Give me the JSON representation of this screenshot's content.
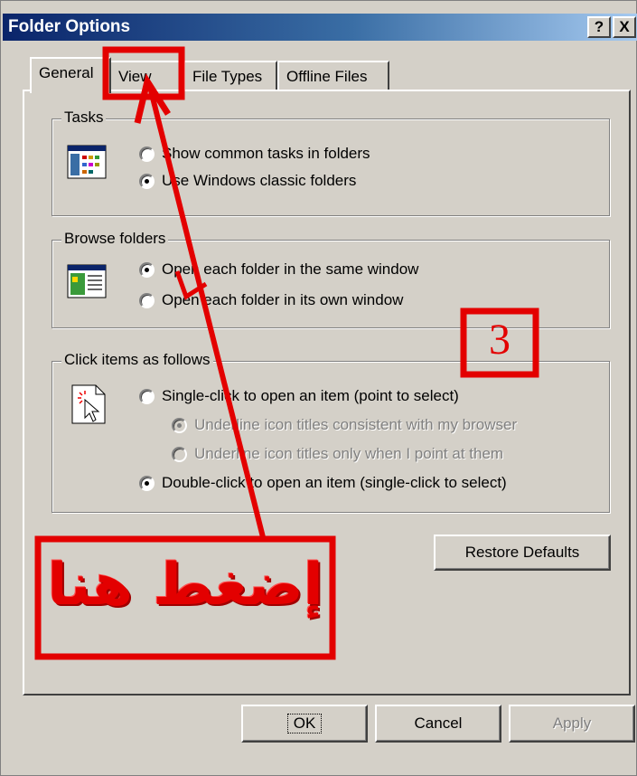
{
  "window": {
    "title": "Folder Options",
    "help_label": "?",
    "close_label": "X"
  },
  "tabs": [
    {
      "label": "General",
      "active": true
    },
    {
      "label": "View",
      "active": false
    },
    {
      "label": "File Types",
      "active": false
    },
    {
      "label": "Offline Files",
      "active": false
    }
  ],
  "groups": {
    "tasks": {
      "label": "Tasks",
      "options": [
        {
          "label": "Show common tasks in folders",
          "checked": false,
          "disabled": false
        },
        {
          "label": "Use Windows classic folders",
          "checked": true,
          "disabled": false
        }
      ]
    },
    "browse": {
      "label": "Browse folders",
      "options": [
        {
          "label": "Open each folder in the same window",
          "checked": true,
          "disabled": false
        },
        {
          "label": "Open each folder in its own window",
          "checked": false,
          "disabled": false
        }
      ]
    },
    "click": {
      "label": "Click items as follows",
      "options": [
        {
          "label": "Single-click to open an item (point to select)",
          "checked": false,
          "disabled": false
        },
        {
          "label": "Underline icon titles consistent with my browser",
          "checked": true,
          "disabled": true
        },
        {
          "label": "Underline icon titles only when I point at them",
          "checked": false,
          "disabled": true
        },
        {
          "label": "Double-click to open an item (single-click to select)",
          "checked": true,
          "disabled": false
        }
      ]
    }
  },
  "buttons": {
    "restore_defaults": "Restore Defaults",
    "ok": "OK",
    "cancel": "Cancel",
    "apply": "Apply"
  },
  "annotation": {
    "step_number": "3",
    "arabic_text": "إضغط هنا",
    "color": "#e30000"
  }
}
